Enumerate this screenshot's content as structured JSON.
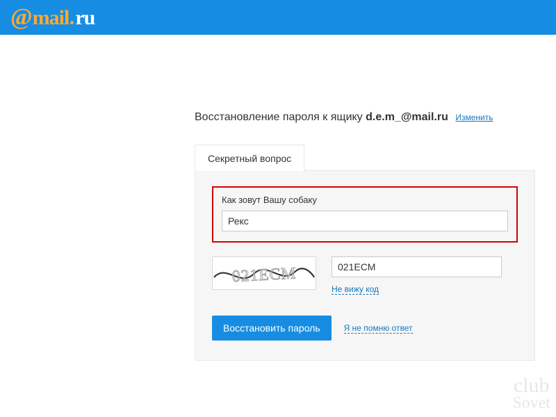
{
  "header": {
    "logo_at": "@",
    "logo_mail": "mail",
    "logo_ru": "ru"
  },
  "title": {
    "prefix": "Восстановление пароля к ящику ",
    "email": "d.e.m_@mail.ru",
    "change_link": "Изменить"
  },
  "tab": {
    "label": "Секретный вопрос"
  },
  "form": {
    "question_label": "Как зовут Вашу собаку",
    "answer_value": "Рекс",
    "captcha_text": "021ECM",
    "captcha_input_value": "021ECM",
    "captcha_refresh_link": "Не вижу код",
    "submit_label": "Восстановить пароль",
    "forgot_link": "Я не помню ответ"
  },
  "watermark": {
    "line1": "club",
    "line2": "Sovet"
  }
}
